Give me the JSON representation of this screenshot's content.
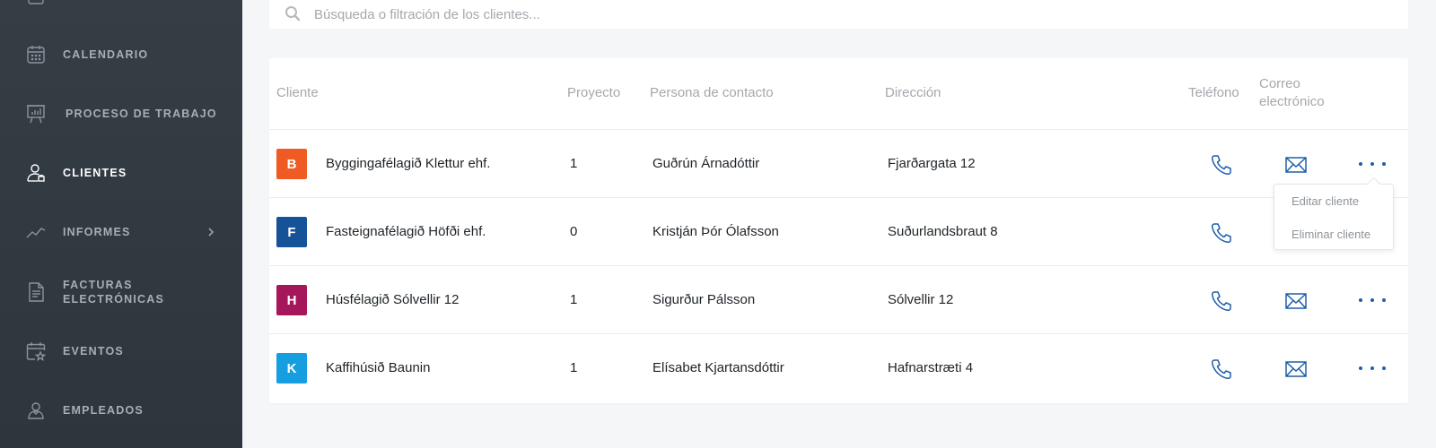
{
  "colors": {
    "sidebar_bg": "#323a42",
    "accent_blue": "#1d5ea8",
    "avatar_orange": "#ef5b23",
    "avatar_dark_blue": "#155297",
    "avatar_magenta": "#a6165a",
    "avatar_light_blue": "#169ee0"
  },
  "sidebar": {
    "items": [
      {
        "label": "CALENDARIO",
        "icon": "calendar-icon"
      },
      {
        "label": "PROCESO DE TRABAJO",
        "icon": "presentation-board-icon"
      },
      {
        "label": "CLIENTES",
        "icon": "client-user-icon",
        "active": true
      },
      {
        "label": "INFORMES",
        "icon": "trend-chart-icon",
        "has_submenu": true
      },
      {
        "label_line1": "FACTURAS",
        "label_line2": "ELECTRÓNICAS",
        "icon": "document-icon"
      },
      {
        "label": "EVENTOS",
        "icon": "calendar-star-icon"
      },
      {
        "label": "EMPLEADOS",
        "icon": "employees-icon"
      }
    ]
  },
  "search": {
    "placeholder": "Búsqueda o filtración de los clientes...",
    "value": ""
  },
  "table": {
    "columns": {
      "client": "Cliente",
      "project": "Proyecto",
      "contact": "Persona de contacto",
      "address": "Dirección",
      "phone": "Teléfono",
      "email_line1": "Correo",
      "email_line2": "electrónico"
    },
    "rows": [
      {
        "initial": "B",
        "name": "Byggingafélagið Klettur ehf.",
        "project": "1",
        "contact": "Guðrún Árnadóttir",
        "address": "Fjarðargata 12"
      },
      {
        "initial": "F",
        "name": "Fasteignafélagið Höfði ehf.",
        "project": "0",
        "contact": "Kristján Þór Ólafsson",
        "address": "Suðurlandsbraut 8"
      },
      {
        "initial": "H",
        "name": "Húsfélagið Sólvellir 12",
        "project": "1",
        "contact": "Sigurður Pálsson",
        "address": "Sólvellir 12"
      },
      {
        "initial": "K",
        "name": "Kaffihúsið Baunin",
        "project": "1",
        "contact": "Elísabet Kjartansdóttir",
        "address": "Hafnarstræti 4"
      }
    ]
  },
  "dropdown": {
    "items": [
      "Editar cliente",
      "Eliminar cliente"
    ]
  }
}
